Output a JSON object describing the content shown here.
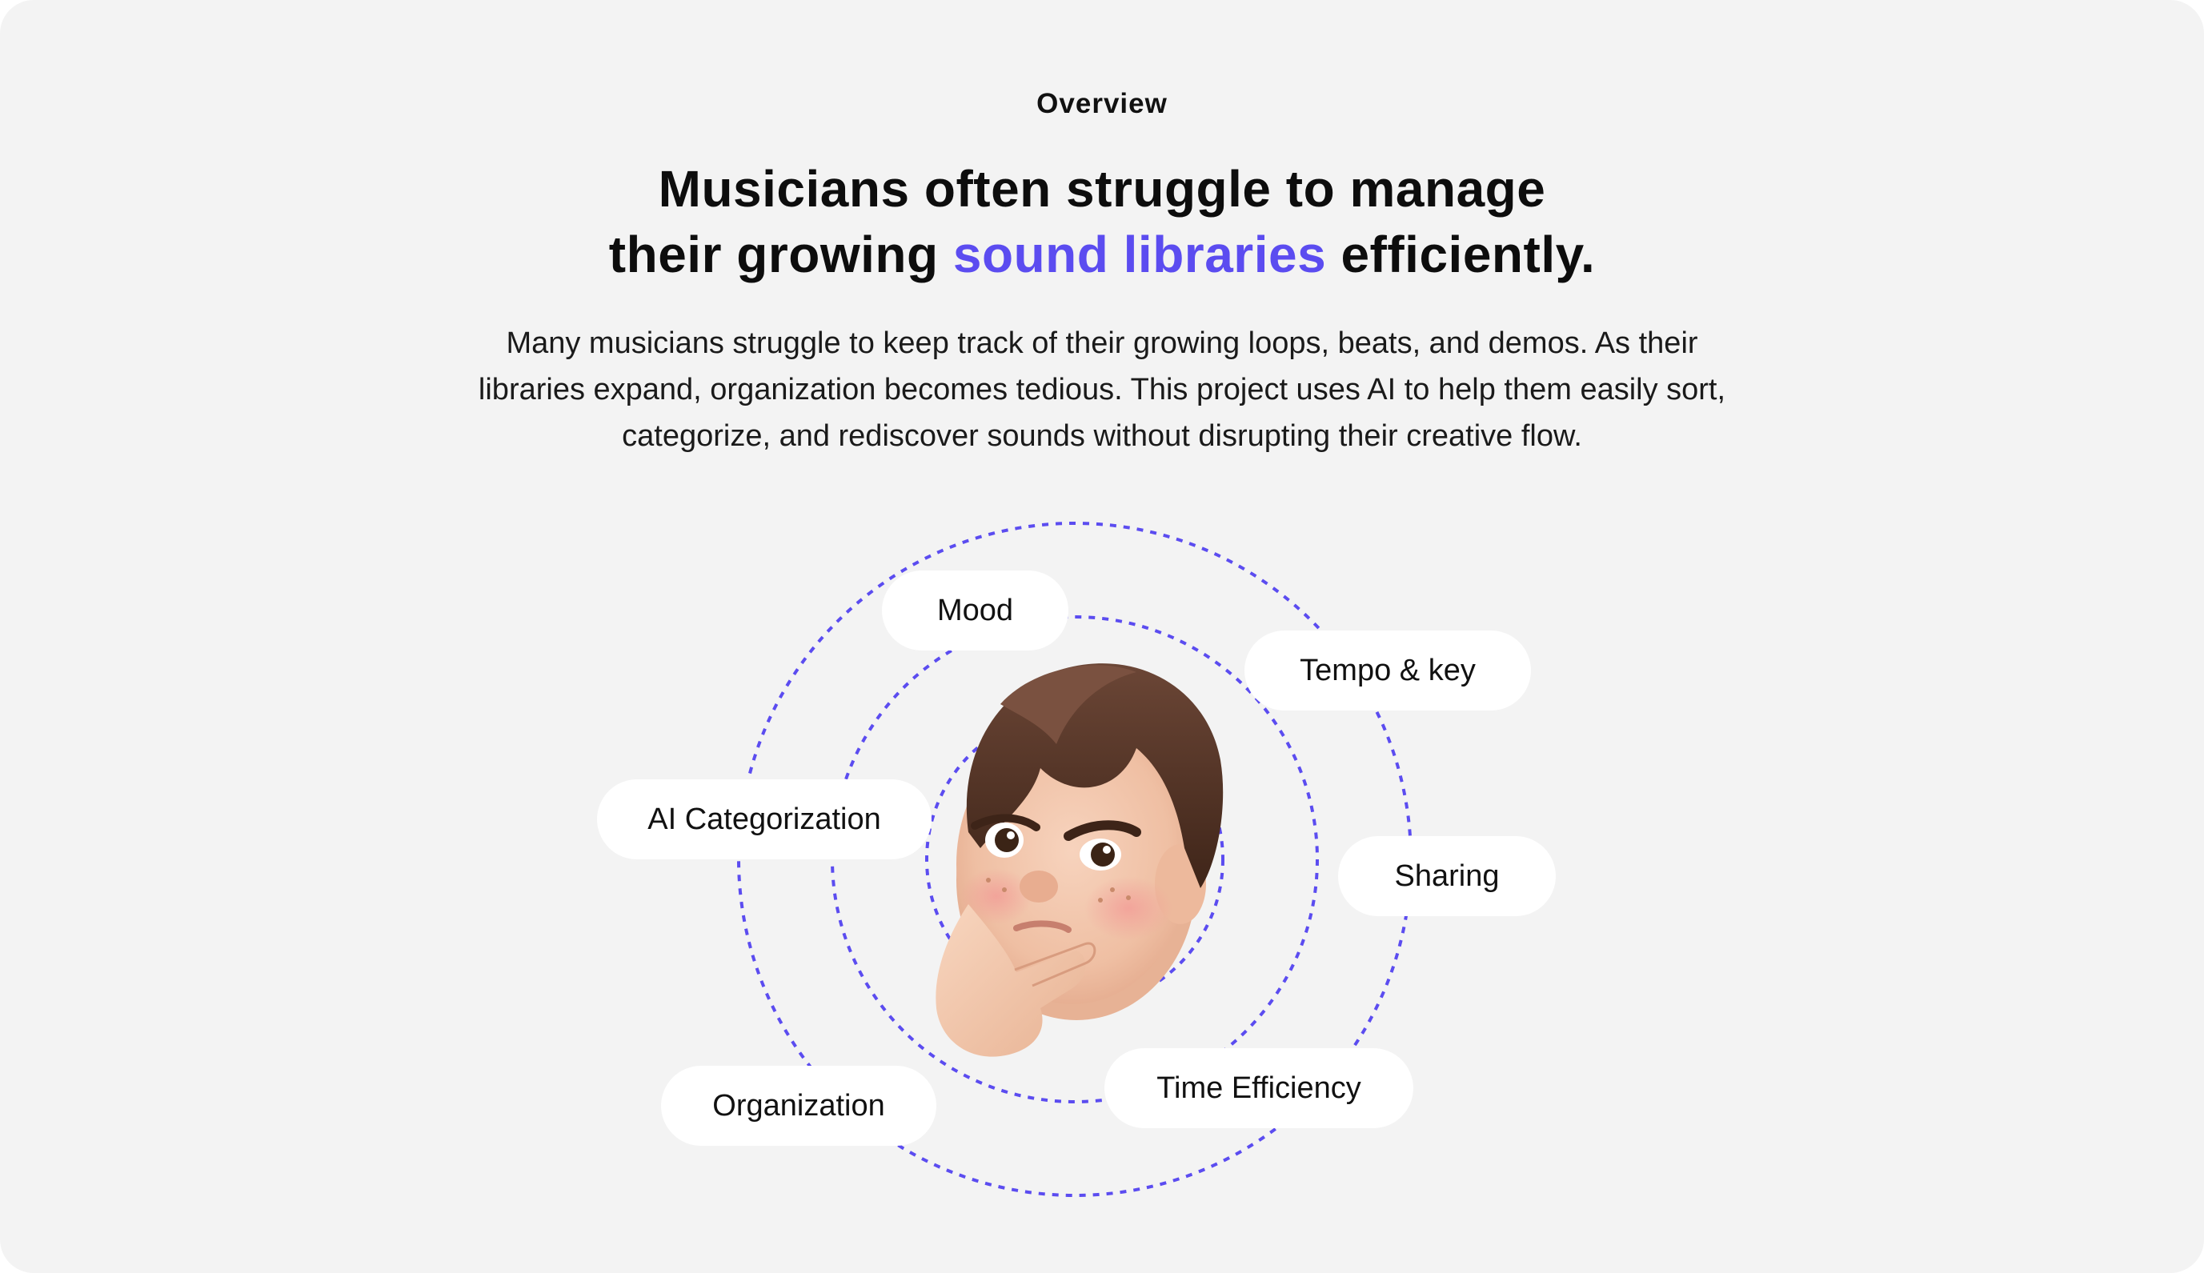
{
  "overview": {
    "eyebrow": "Overview",
    "headline_line1": "Musicians often struggle to manage",
    "headline_line2_prefix": "their growing ",
    "headline_accent": "sound libraries",
    "headline_line2_suffix": " efficiently.",
    "body": "Many musicians struggle to keep track of their growing loops, beats, and demos. As their libraries expand, organization becomes tedious. This project uses AI to help them easily sort, categorize, and rediscover sounds without disrupting their creative flow."
  },
  "diagram": {
    "tags": [
      {
        "name": "tag-mood",
        "label": "Mood"
      },
      {
        "name": "tag-tempo-key",
        "label": "Tempo & key"
      },
      {
        "name": "tag-ai-categorization",
        "label": "AI Categorization"
      },
      {
        "name": "tag-sharing",
        "label": "Sharing"
      },
      {
        "name": "tag-time-efficiency",
        "label": "Time Efficiency"
      },
      {
        "name": "tag-organization",
        "label": "Organization"
      }
    ],
    "avatar": "thinking-memoji"
  },
  "colors": {
    "accent": "#5b4cf0",
    "card_background": "#f3f3f3",
    "ring": "#5b4cf0"
  }
}
